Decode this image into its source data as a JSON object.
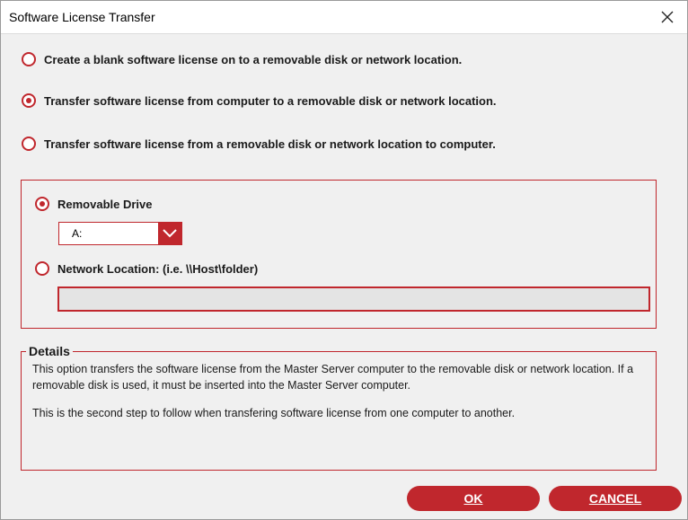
{
  "window": {
    "title": "Software License Transfer"
  },
  "options": [
    {
      "label": "Create a blank software license on to a removable disk or network location.",
      "selected": false
    },
    {
      "label": "Transfer software license from computer to a removable disk or network location.",
      "selected": true
    },
    {
      "label": "Transfer software license from a removable disk or network location to computer.",
      "selected": false
    }
  ],
  "destination": {
    "removable": {
      "label": "Removable Drive",
      "selected": true
    },
    "drive_select": {
      "value": "A:"
    },
    "network": {
      "label": "Network Location: (i.e. \\\\Host\\folder)",
      "selected": false
    },
    "network_input": {
      "value": ""
    }
  },
  "details": {
    "legend": "Details",
    "paragraph1": "This option transfers the software license from the Master Server computer to the removable disk or network location.  If a removable disk is used, it must be inserted into the Master Server computer.",
    "paragraph2": "This is the second step to follow when transfering software license from one computer to another."
  },
  "buttons": {
    "ok": "OK",
    "cancel": "CANCEL"
  },
  "colors": {
    "accent": "#c0272d",
    "background": "#f0f0f0",
    "input_disabled": "#e4e4e4"
  },
  "icons": {
    "close": "close-icon",
    "dropdown": "chevron-down-icon"
  }
}
